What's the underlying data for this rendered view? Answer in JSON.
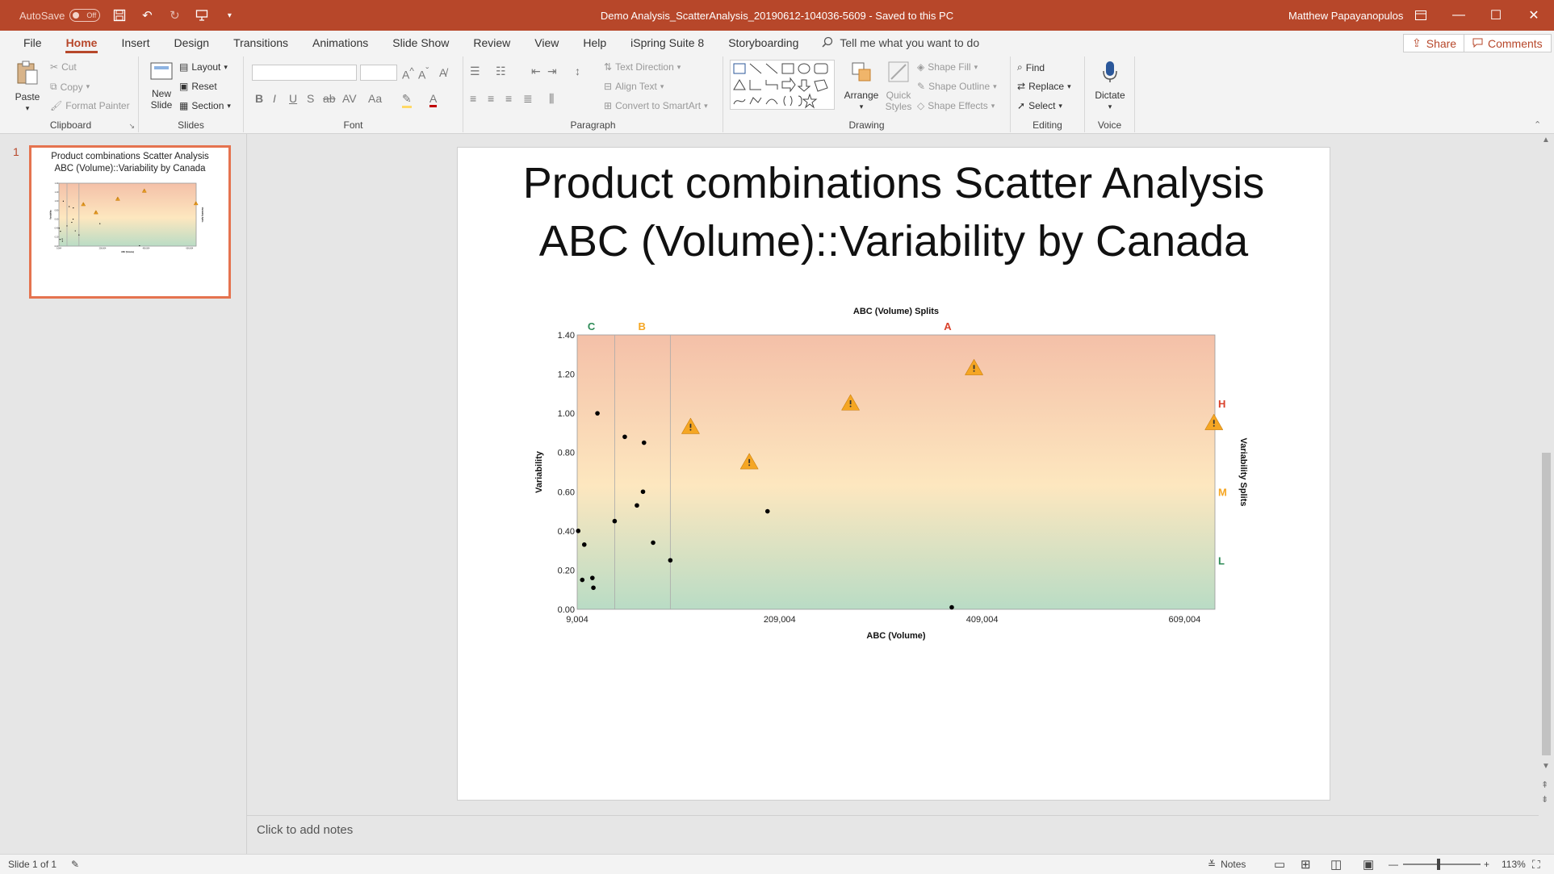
{
  "titlebar": {
    "autosave_label": "AutoSave",
    "autosave_state": "Off",
    "doc_title": "Demo Analysis_ScatterAnalysis_20190612-104036-5609  -  Saved to this PC",
    "user": "Matthew Papayanopulos"
  },
  "menu": {
    "tabs": [
      "File",
      "Home",
      "Insert",
      "Design",
      "Transitions",
      "Animations",
      "Slide Show",
      "Review",
      "View",
      "Help",
      "iSpring Suite 8",
      "Storyboarding"
    ],
    "active_tab": "Home",
    "tell_me": "Tell me what you want to do",
    "share": "Share",
    "comments": "Comments"
  },
  "ribbon": {
    "clipboard": {
      "label": "Clipboard",
      "paste": "Paste",
      "cut": "Cut",
      "copy": "Copy",
      "format_painter": "Format Painter"
    },
    "slides": {
      "label": "Slides",
      "new_slide_1": "New",
      "new_slide_2": "Slide",
      "layout": "Layout",
      "reset": "Reset",
      "section": "Section"
    },
    "font": {
      "label": "Font"
    },
    "paragraph": {
      "label": "Paragraph",
      "text_direction": "Text Direction",
      "align_text": "Align Text",
      "convert_smartart": "Convert to SmartArt"
    },
    "drawing": {
      "label": "Drawing",
      "arrange": "Arrange",
      "quick_styles_1": "Quick",
      "quick_styles_2": "Styles",
      "shape_fill": "Shape Fill",
      "shape_outline": "Shape Outline",
      "shape_effects": "Shape Effects"
    },
    "editing": {
      "label": "Editing",
      "find": "Find",
      "replace": "Replace",
      "select": "Select"
    },
    "voice": {
      "label": "Voice",
      "dictate": "Dictate"
    }
  },
  "thumbnail": {
    "number": "1",
    "title_line1": "Product combinations Scatter Analysis",
    "title_line2": "ABC (Volume)::Variability by Canada"
  },
  "slide": {
    "title_line1": "Product combinations Scatter Analysis",
    "title_line2": "ABC (Volume)::Variability by Canada"
  },
  "chart_data": {
    "type": "scatter",
    "title": "ABC (Volume) Splits",
    "xlabel": "ABC (Volume)",
    "ylabel": "Variability",
    "y2label": "Variability Splits",
    "xlim": [
      9004,
      639004
    ],
    "ylim": [
      0,
      1.4
    ],
    "x_ticks": [
      9004,
      209004,
      409004,
      609004
    ],
    "x_tick_labels": [
      "9,004",
      "209,004",
      "409,004",
      "609,004"
    ],
    "y_ticks": [
      0,
      0.2,
      0.4,
      0.6,
      0.8,
      1.0,
      1.2,
      1.4
    ],
    "y_tick_labels": [
      "0.00",
      "0.20",
      "0.40",
      "0.60",
      "0.80",
      "1.00",
      "1.20",
      "1.40"
    ],
    "x_split_lines": [
      46000,
      101000
    ],
    "x_split_labels": [
      {
        "label": "C",
        "x": 23000,
        "color": "#2e8b57"
      },
      {
        "label": "B",
        "x": 73000,
        "color": "#f5a623"
      },
      {
        "label": "A",
        "x": 375000,
        "color": "#d9412b"
      }
    ],
    "y_split_labels": [
      {
        "label": "H",
        "y": 1.05,
        "color": "#d9412b"
      },
      {
        "label": "M",
        "y": 0.6,
        "color": "#f5a623"
      },
      {
        "label": "L",
        "y": 0.25,
        "color": "#2e8b57"
      }
    ],
    "colors": {
      "top": "#f4c0a8",
      "middle": "#fde7bf",
      "bottom": "#b9dcc5",
      "dot": "#000000",
      "warning": "#f5a623"
    },
    "series": [
      {
        "marker": "dot",
        "points": [
          [
            10000,
            0.4
          ],
          [
            14000,
            0.15
          ],
          [
            16000,
            0.33
          ],
          [
            24000,
            0.16
          ],
          [
            25000,
            0.11
          ],
          [
            29000,
            1.0
          ],
          [
            46000,
            0.45
          ],
          [
            56000,
            0.88
          ],
          [
            68000,
            0.53
          ],
          [
            74000,
            0.6
          ],
          [
            75000,
            0.85
          ],
          [
            84000,
            0.34
          ],
          [
            101000,
            0.25
          ],
          [
            197000,
            0.5
          ],
          [
            379000,
            0.01
          ]
        ]
      },
      {
        "marker": "warning",
        "points": [
          [
            121000,
            0.93
          ],
          [
            179000,
            0.75
          ],
          [
            279000,
            1.05
          ],
          [
            401000,
            1.23
          ],
          [
            638000,
            0.95
          ]
        ]
      }
    ]
  },
  "notes": {
    "placeholder": "Click to add notes"
  },
  "status": {
    "slide_info": "Slide 1 of 1",
    "notes": "Notes",
    "zoom": "113%"
  }
}
